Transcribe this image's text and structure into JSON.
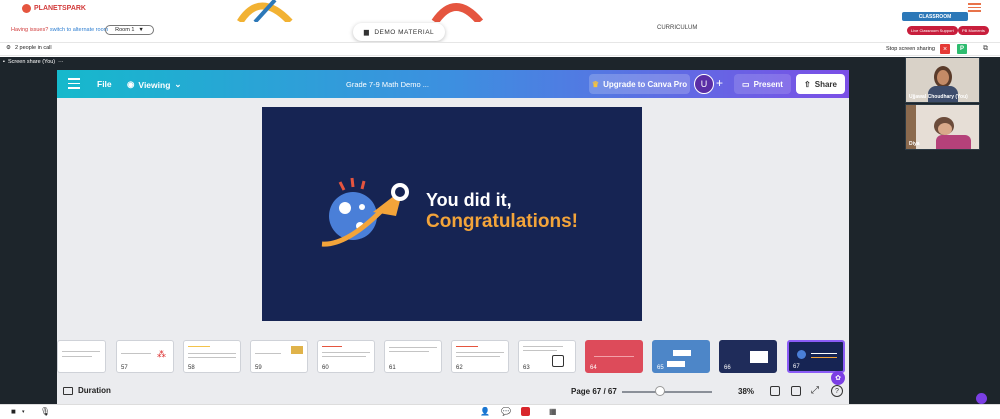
{
  "platform": {
    "logo_text": "PLANETSPARK",
    "issues_text": "Having issues?",
    "alt_room_link": "switch to alternate room",
    "room_label": "Room 1",
    "demo_material_label": "DEMO MATERIAL",
    "curriculum_label": "CURRICULUM",
    "classroom_label": "CLASSROOM",
    "live_support_label": "Live Classroom Support",
    "pb_moments_label": "PB Moments"
  },
  "call": {
    "people_text": "2 people in call",
    "stop_share_label": "Stop screen sharing",
    "stop_x": "×",
    "p_badge": "P",
    "screen_share_label": "Screen share (You)",
    "screen_share_more": "···"
  },
  "canva": {
    "file_label": "File",
    "viewing_label": "Viewing",
    "doc_title": "Grade 7-9 Math Demo ...",
    "upgrade_label": "Upgrade to Canva Pro",
    "avatar_initial": "U",
    "present_label": "Present",
    "share_label": "Share",
    "slide": {
      "line1": "You did it,",
      "line2": "Congratulations!"
    },
    "thumbnails": [
      "57",
      "58",
      "59",
      "60",
      "61",
      "62",
      "63",
      "64",
      "65",
      "66",
      "67"
    ],
    "duration_label": "Duration",
    "page_label": "Page 67 / 67",
    "zoom_label": "38%",
    "help_label": "?",
    "page_progress": 0.37
  },
  "participants": [
    {
      "name": "Ujjawal Choudhary (You)"
    },
    {
      "name": "Diya"
    }
  ],
  "colors": {
    "canva_gradient_start": "#16b9cc",
    "canva_gradient_end": "#7b4fe6",
    "slide_bg": "#162453",
    "congrats_orange": "#f3a43a",
    "support_red": "#c81e3c",
    "classroom_blue": "#2c78b8"
  }
}
